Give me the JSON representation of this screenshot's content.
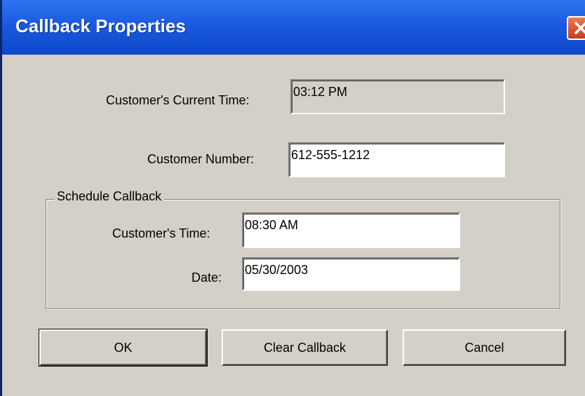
{
  "window": {
    "title": "Callback Properties"
  },
  "fields": {
    "current_time": {
      "label": "Customer's Current Time:",
      "value": "03:12 PM"
    },
    "customer_number": {
      "label": "Customer Number:",
      "value": "612-555-1212"
    }
  },
  "schedule": {
    "group_title": "Schedule Callback",
    "customer_time": {
      "label": "Customer's Time:",
      "value": "08:30 AM"
    },
    "date": {
      "label": "Date:",
      "value": "05/30/2003"
    }
  },
  "buttons": {
    "ok": "OK",
    "clear": "Clear Callback",
    "cancel": "Cancel"
  },
  "icons": {
    "close": "close-icon"
  },
  "colors": {
    "titlebar": "#1a5ae0",
    "close_button": "#d8532e",
    "dialog_face": "#d4d0c8"
  }
}
